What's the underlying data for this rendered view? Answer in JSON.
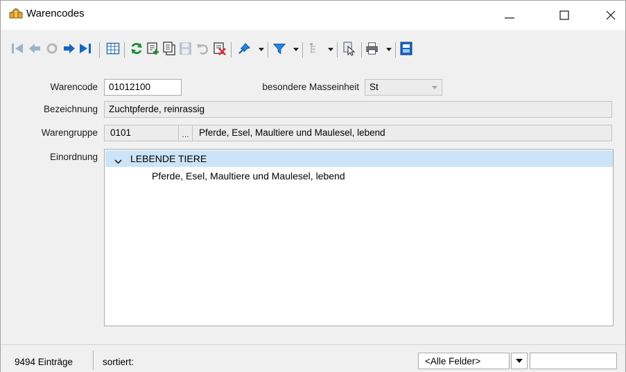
{
  "window": {
    "title": "Warencodes",
    "controls": {
      "minimize": "—",
      "maximize": "☐",
      "close": "✕"
    }
  },
  "toolbar": {
    "icons": [
      "first-record-icon",
      "previous-record-icon",
      "refresh-disabled-icon",
      "next-record-icon",
      "last-record-icon",
      "table-view-icon",
      "reload-icon",
      "new-record-icon",
      "copy-record-icon",
      "save-icon",
      "undo-icon",
      "delete-icon",
      "pin-icon",
      "filter-icon",
      "tree-icon",
      "cursor-icon",
      "print-icon",
      "export-icon"
    ]
  },
  "form": {
    "warencode_label": "Warencode",
    "warencode_value": "01012100",
    "masseinheit_label": "besondere Masseinheit",
    "masseinheit_value": "St",
    "bezeichnung_label": "Bezeichnung",
    "bezeichnung_value": "Zuchtpferde, reinrassig",
    "warengruppe_label": "Warengruppe",
    "warengruppe_code": "0101",
    "warengruppe_browse": "...",
    "warengruppe_text": "Pferde, Esel, Maultiere und Maulesel, lebend",
    "einordnung_label": "Einordnung"
  },
  "tree": {
    "root": "LEBENDE TIERE",
    "child": "Pferde, Esel, Maultiere und Maulesel, lebend"
  },
  "status": {
    "count": "9494 Einträge",
    "sorted": "sortiert:",
    "field_combo": "<Alle Felder>",
    "search_value": ""
  },
  "colors": {
    "nav_arrow": "#1565c0",
    "reload_green": "#1e8b2e",
    "delete_red": "#d32f2f",
    "selection": "#cce4f7"
  }
}
